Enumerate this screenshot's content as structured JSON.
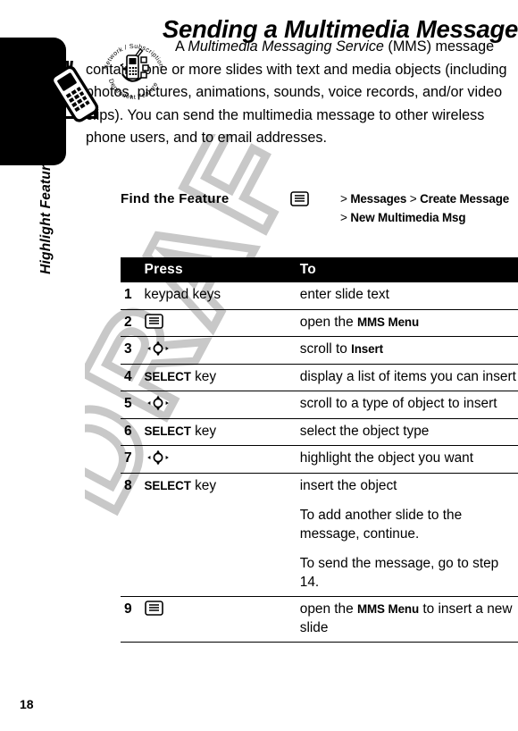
{
  "page_title": "Sending a Multimedia Message",
  "sidebar": {
    "section_label": "Highlight Features",
    "page_number": "18"
  },
  "badge": {
    "top_text": "Network / Subscription",
    "bottom_text": "Dependent Feature",
    "icon": "network-dependent-feature-badge"
  },
  "illustration": {
    "icon": "running-phone-icon"
  },
  "intro": {
    "lead": "A ",
    "emphasis": "Multimedia Messaging Service",
    "rest": " (MMS) message contains one or more slides with text and media objects (including photos, pictures, animations, sounds, voice records, and/or video clips). You can send the multimedia message to other wireless phone users, and to email addresses."
  },
  "find_feature": {
    "label": "Find the Feature",
    "menu_icon": "menu-key-icon",
    "path_line1_sep1": ">",
    "path_line1_item1": "Messages",
    "path_line1_sep2": ">",
    "path_line1_item2": "Create Message",
    "path_line2_sep": ">",
    "path_line2_item": "New Multimedia Msg"
  },
  "steps_table": {
    "headers": {
      "num": "",
      "press": "Press",
      "to": "To"
    },
    "rows": [
      {
        "num": "1",
        "press_text": "keypad keys",
        "press_icon": "",
        "to_main_pre": "enter slide text",
        "to_main_bold": "",
        "to_main_post": "",
        "to_extra1": "",
        "to_extra2": ""
      },
      {
        "num": "2",
        "press_text": "",
        "press_icon": "menu-key-icon",
        "to_main_pre": "open the ",
        "to_main_bold": "MMS Menu",
        "to_main_post": "",
        "to_extra1": "",
        "to_extra2": ""
      },
      {
        "num": "3",
        "press_text": "",
        "press_icon": "nav-key-icon",
        "to_main_pre": "scroll to ",
        "to_main_bold": "Insert",
        "to_main_post": "",
        "to_extra1": "",
        "to_extra2": ""
      },
      {
        "num": "4",
        "press_text": "key",
        "press_bold": "SELECT",
        "press_icon": "",
        "to_main_pre": "display a list of items you can insert",
        "to_main_bold": "",
        "to_main_post": "",
        "to_extra1": "",
        "to_extra2": ""
      },
      {
        "num": "5",
        "press_text": "",
        "press_icon": "nav-key-icon",
        "to_main_pre": "scroll to a type of object to insert",
        "to_main_bold": "",
        "to_main_post": "",
        "to_extra1": "",
        "to_extra2": ""
      },
      {
        "num": "6",
        "press_text": "key",
        "press_bold": "SELECT",
        "press_icon": "",
        "to_main_pre": "select the object type",
        "to_main_bold": "",
        "to_main_post": "",
        "to_extra1": "",
        "to_extra2": ""
      },
      {
        "num": "7",
        "press_text": "",
        "press_icon": "nav-key-icon",
        "to_main_pre": "highlight the object you want",
        "to_main_bold": "",
        "to_main_post": "",
        "to_extra1": "",
        "to_extra2": ""
      },
      {
        "num": "8",
        "press_text": "key",
        "press_bold": "SELECT",
        "press_icon": "",
        "to_main_pre": "insert the object",
        "to_main_bold": "",
        "to_main_post": "",
        "to_extra1": "To add another slide to the message, continue.",
        "to_extra2": "To send the message, go to step 14."
      },
      {
        "num": "9",
        "press_text": "",
        "press_icon": "menu-key-icon",
        "to_main_pre": "open the ",
        "to_main_bold": "MMS Menu",
        "to_main_post": " to insert a new slide",
        "to_extra1": "",
        "to_extra2": ""
      }
    ]
  },
  "watermark": {
    "text": "DRAFT",
    "color": "#c8c8c8"
  }
}
